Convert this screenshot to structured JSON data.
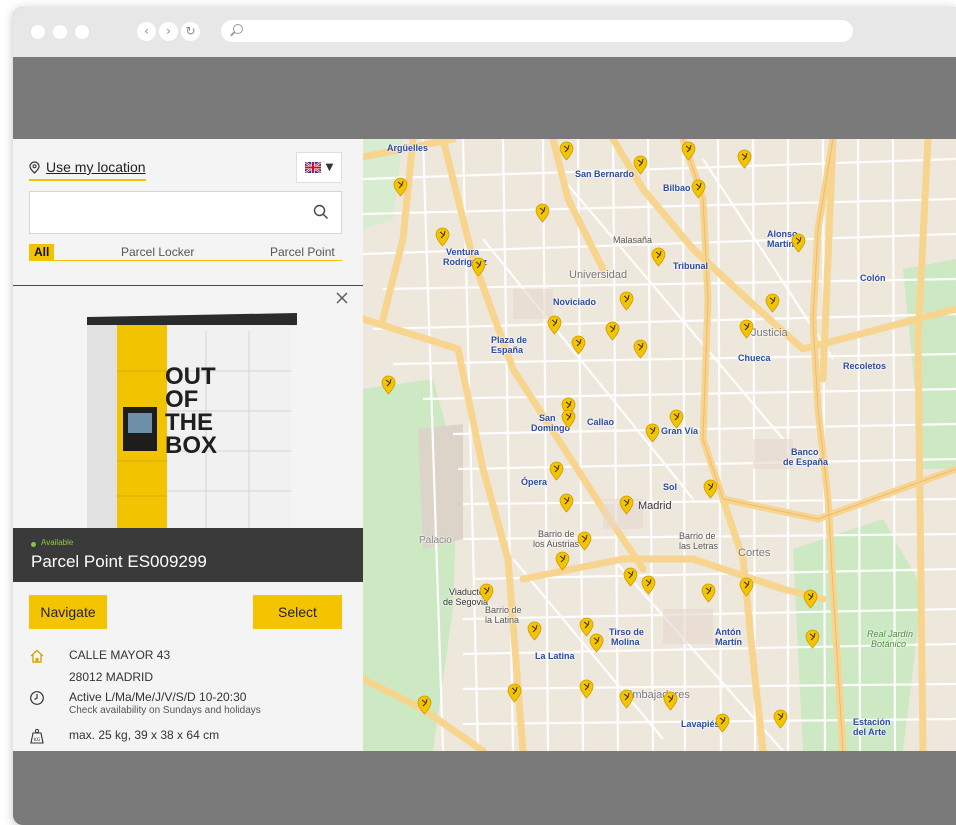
{
  "location": {
    "label": "Use my location"
  },
  "search": {
    "value": "",
    "placeholder": ""
  },
  "filters": {
    "all": "All",
    "locker": "Parcel Locker",
    "point": "Parcel Point"
  },
  "photo": {
    "locker_text": [
      "OUT",
      "OF",
      "THE",
      "BOX"
    ]
  },
  "point": {
    "status": "Available",
    "name": "Parcel Point ES009299"
  },
  "actions": {
    "navigate": "Navigate",
    "select": "Select"
  },
  "address": {
    "street": "CALLE MAYOR 43",
    "city": "28012 MADRID"
  },
  "hours": {
    "schedule": "Active L/Ma/Me/J/V/S/D 10-20:30",
    "note": "Check availability on Sundays and holidays"
  },
  "limits": {
    "text": "max. 25 kg, 39 x 38 x 64 cm"
  },
  "map": {
    "labels": {
      "arguelles": "Argüelles",
      "sanbernardo": "San Bernardo",
      "bilbao": "Bilbao",
      "malasana": "Malasaña",
      "tribunal": "Tribunal",
      "universidad": "Universidad",
      "noviciado": "Noviciado",
      "ventura": "Ventura",
      "rodriguez": "Rodríguez",
      "plaza": "Plaza de",
      "espana": "España",
      "justicia": "Justicia",
      "chueca": "Chueca",
      "colon": "Colón",
      "recoletos": "Recoletos",
      "sandomingo": "San",
      "domingo": "Domingo",
      "callao": "Callao",
      "granvia": "Gran Vía",
      "opera": "Ópera",
      "sol": "Sol",
      "madrid": "Madrid",
      "banco": "Banco",
      "bancoesp": "de España",
      "cortes": "Cortes",
      "letras": "Barrio de",
      "letras2": "las Letras",
      "austrias": "Barrio de",
      "austrias2": "los Austrias",
      "viaducto": "Viaducto",
      "segovia": "de Segovia",
      "latina": "Barrio de",
      "latina2": "la Latina",
      "lalatina": "La Latina",
      "tirso": "Tirso de",
      "molina": "Molina",
      "anton": "Antón",
      "martin": "Martín",
      "lavapies": "Lavapiés",
      "embajadores": "Embajadores",
      "estacion": "Estación",
      "delarte": "del Arte",
      "jardin": "Real Jardín",
      "botanico": "Botánico",
      "palacio": "Palacio",
      "alonso": "Alonso",
      "martinez": "Martín"
    },
    "marker_color": "#f5c400"
  }
}
